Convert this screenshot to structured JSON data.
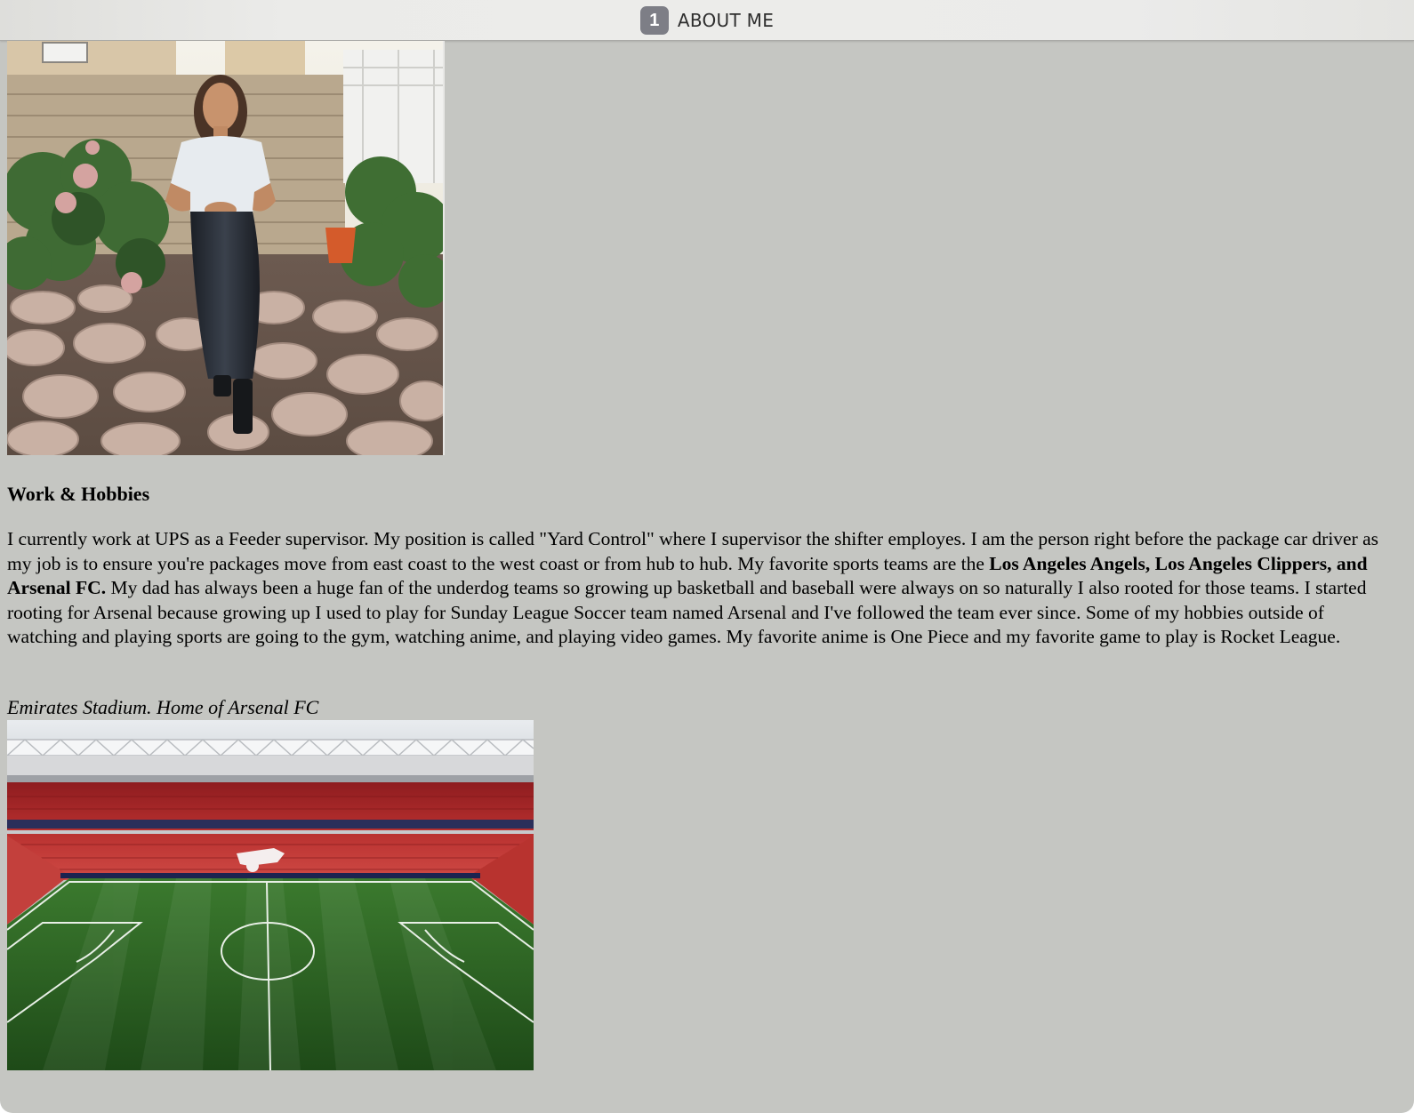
{
  "window": {
    "tab_number": "1",
    "title": "ABOUT ME"
  },
  "content": {
    "portrait_image": {
      "description_icon": "portrait-photo"
    },
    "heading": "Work & Hobbies",
    "bio": {
      "text_before_bold": "I currently work at UPS as a Feeder supervisor. My position is called \"Yard Control\" where I supervisor the shifter employes. I am the person right before the package car driver as my job is to ensure you're packages move from east coast to the west coast or from hub to hub. My favorite sports teams are the ",
      "bold_text": "Los Angeles Angels, Los Angeles Clippers, and Arsenal FC.",
      "text_after_bold": " My dad has always been a huge fan of the underdog teams so growing up basketball and baseball were always on so naturally I also rooted for those teams. I started rooting for Arsenal because growing up I used to play for Sunday League Soccer team named Arsenal and I've followed the team ever since. Some of my hobbies outside of watching and playing sports are going to the gym, watching anime, and playing video games. My favorite anime is One Piece and my favorite game to play is Rocket League."
    },
    "caption": "Emirates Stadium. Home of Arsenal FC",
    "stadium_image": {
      "description_icon": "stadium-photo"
    }
  }
}
